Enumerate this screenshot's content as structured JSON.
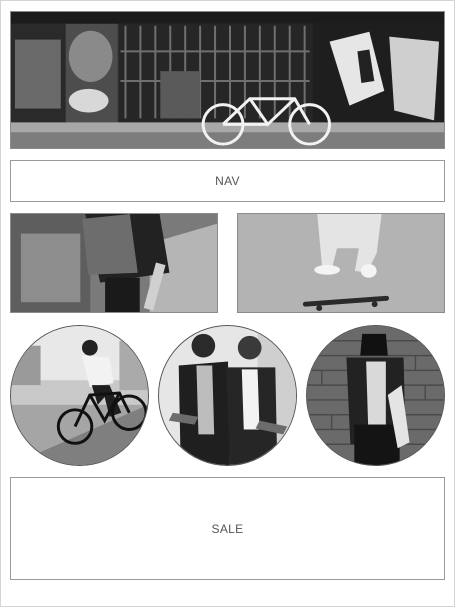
{
  "hero": {
    "image": "graffiti-street-bicycle-photo"
  },
  "nav": {
    "label": "NAV"
  },
  "tiles": [
    {
      "image": "skater-backpack-photo"
    },
    {
      "image": "skateboard-jump-photo"
    }
  ],
  "circles": [
    {
      "image": "cyclist-photo"
    },
    {
      "image": "couple-skateboards-photo"
    },
    {
      "image": "brick-wall-skater-photo"
    }
  ],
  "sale": {
    "label": "SALE"
  }
}
